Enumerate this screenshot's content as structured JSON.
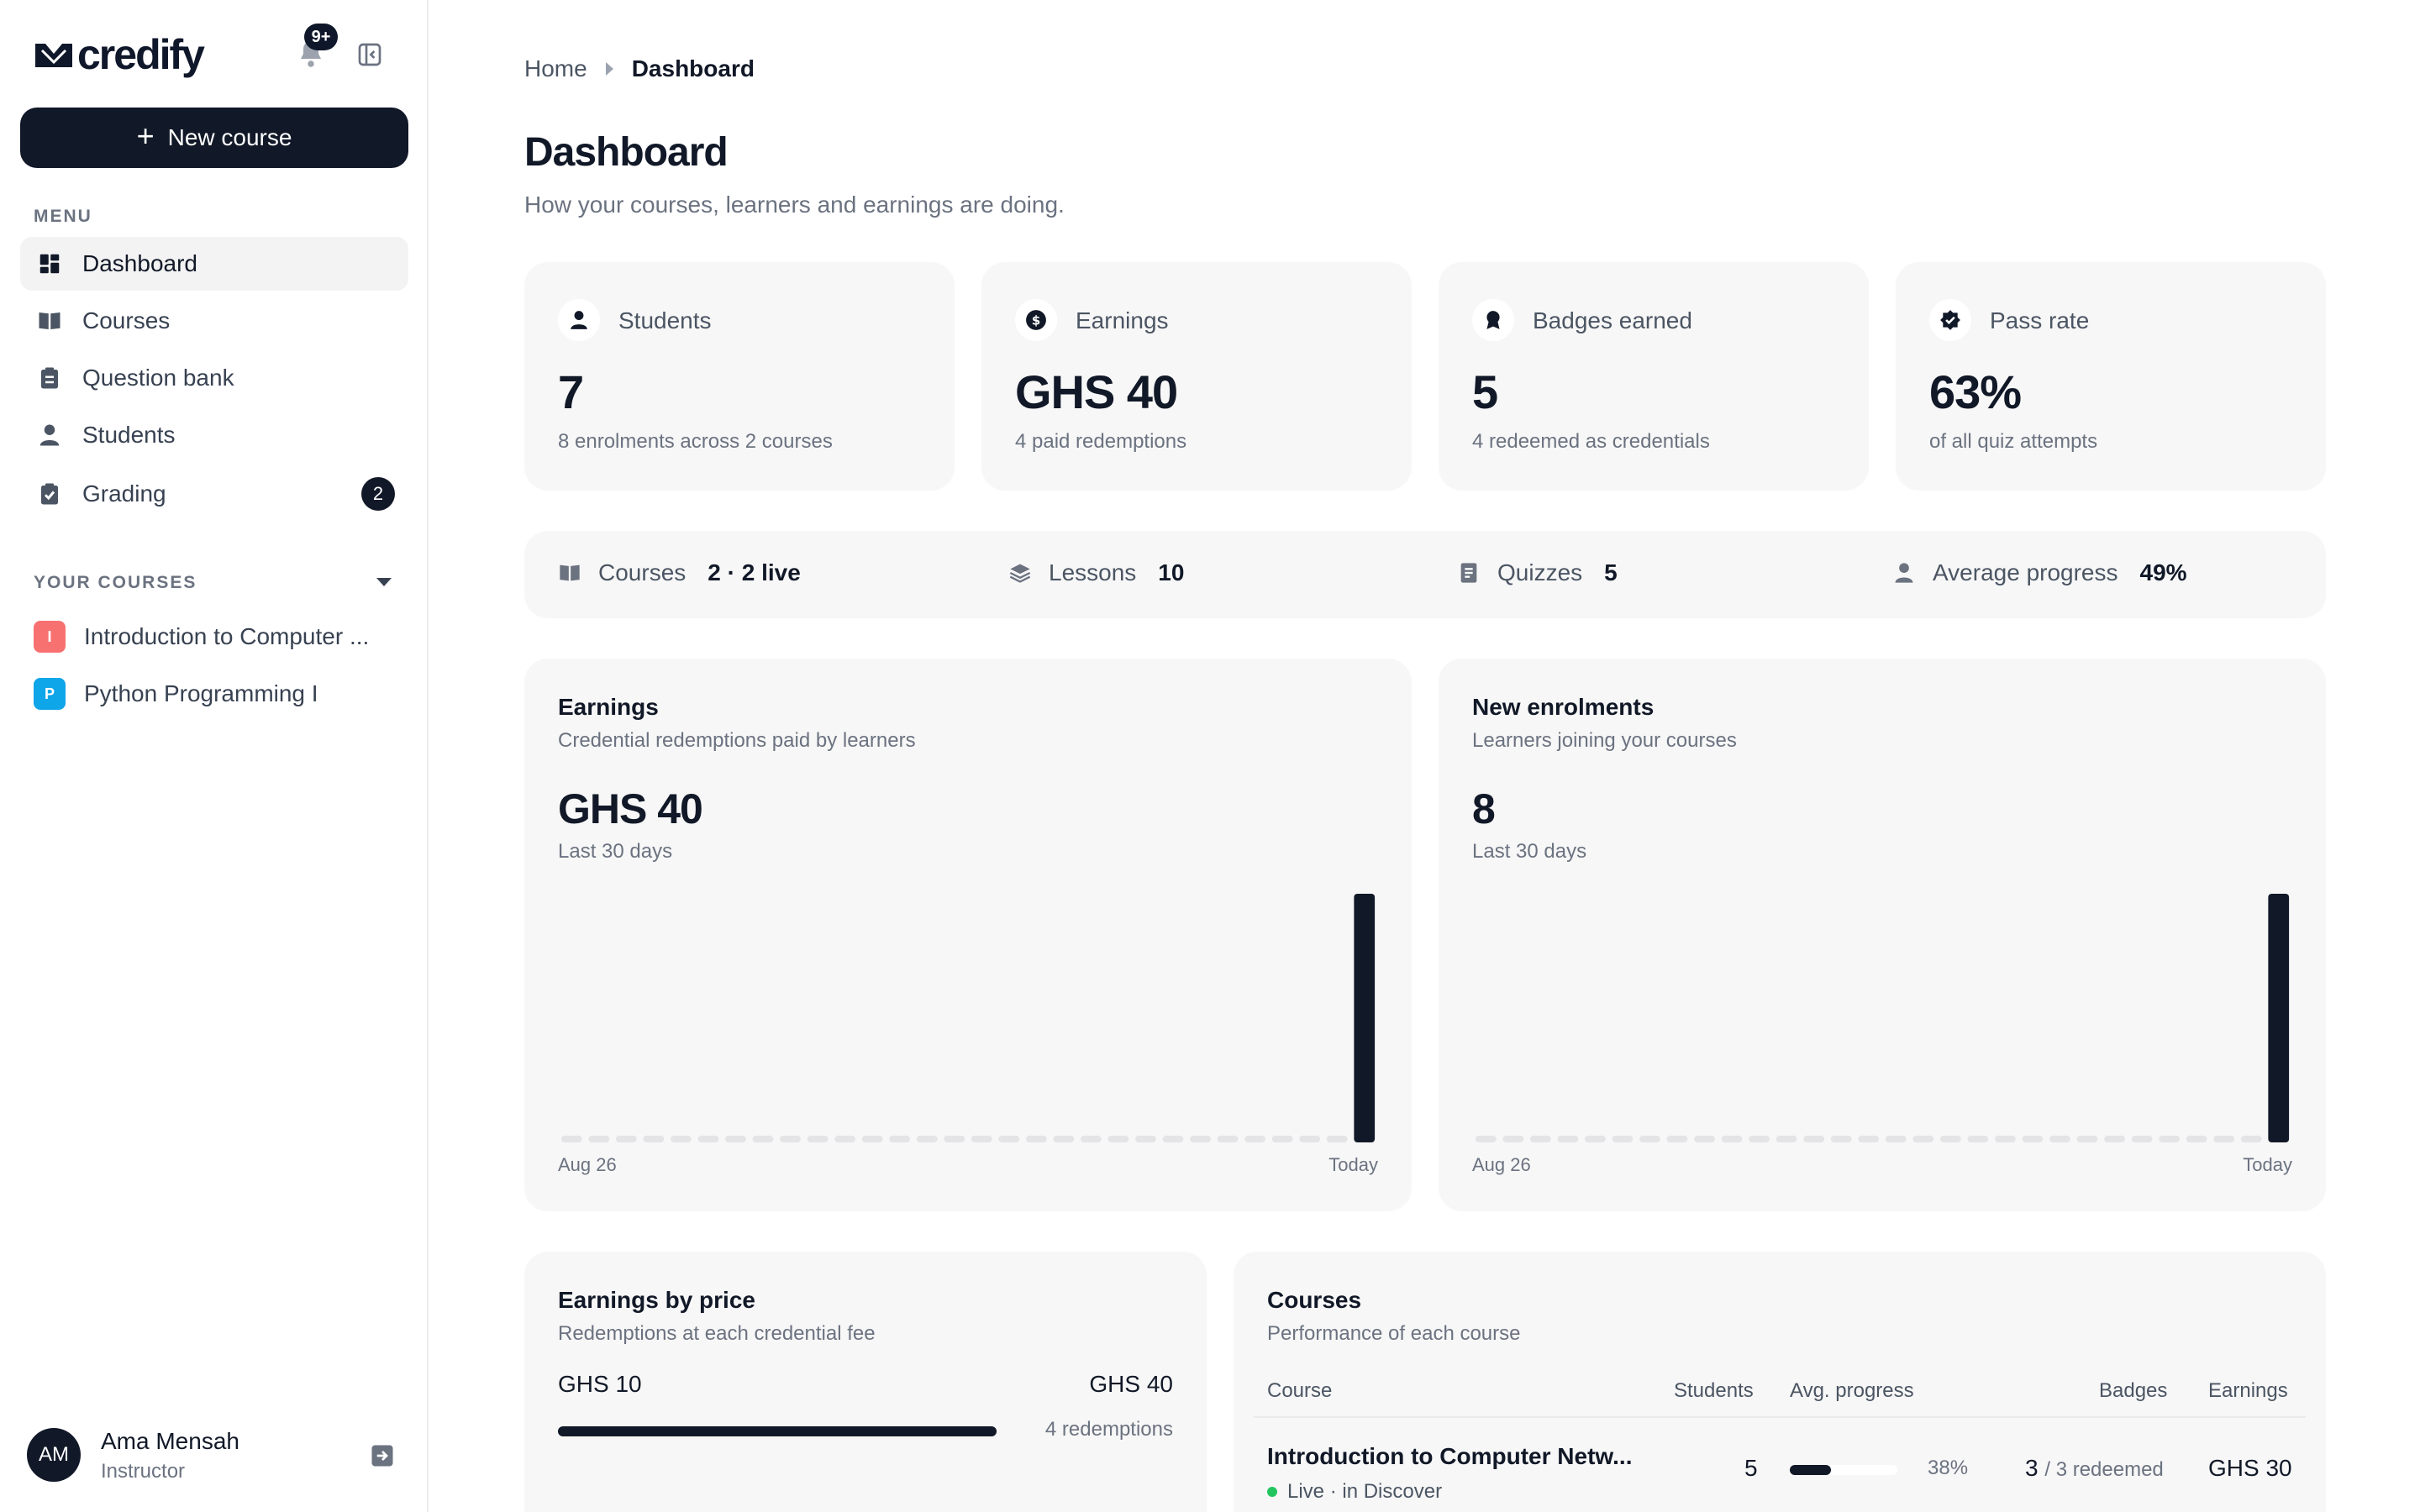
{
  "brand": {
    "name": "credify"
  },
  "notifications": {
    "badge": "9+"
  },
  "sidebar": {
    "new_course_label": "New course",
    "menu_label": "MENU",
    "items": [
      {
        "label": "Dashboard",
        "icon": "dashboard-icon",
        "active": true
      },
      {
        "label": "Courses",
        "icon": "book-icon"
      },
      {
        "label": "Question bank",
        "icon": "clipboard-icon"
      },
      {
        "label": "Students",
        "icon": "person-icon"
      },
      {
        "label": "Grading",
        "icon": "clipboard-check-icon",
        "count": "2"
      }
    ],
    "your_courses_label": "YOUR COURSES",
    "courses": [
      {
        "initial": "I",
        "label": "Introduction to Computer ...",
        "color": "#f87171"
      },
      {
        "initial": "P",
        "label": "Python Programming I",
        "color": "#0ea5e9"
      }
    ],
    "user": {
      "initials": "AM",
      "name": "Ama Mensah",
      "role": "Instructor"
    }
  },
  "breadcrumb": {
    "home": "Home",
    "current": "Dashboard"
  },
  "page": {
    "title": "Dashboard",
    "subtitle": "How your courses, learners and earnings are doing."
  },
  "stats": [
    {
      "label": "Students",
      "value": "7",
      "sub": "8 enrolments across 2 courses",
      "icon": "person-icon"
    },
    {
      "label": "Earnings",
      "value": "GHS 40",
      "sub": "4 paid redemptions",
      "icon": "dollar-icon"
    },
    {
      "label": "Badges earned",
      "value": "5",
      "sub": "4 redeemed as credentials",
      "icon": "award-icon"
    },
    {
      "label": "Pass rate",
      "value": "63%",
      "sub": "of all quiz attempts",
      "icon": "check-badge-icon"
    }
  ],
  "summary": [
    {
      "label": "Courses",
      "value": "2 · 2 live",
      "icon": "book-icon"
    },
    {
      "label": "Lessons",
      "value": "10",
      "icon": "layers-icon"
    },
    {
      "label": "Quizzes",
      "value": "5",
      "icon": "document-icon"
    },
    {
      "label": "Average progress",
      "value": "49%",
      "icon": "person-icon"
    }
  ],
  "earnings_panel": {
    "title": "Earnings",
    "subtitle": "Credential redemptions paid by learners",
    "total": "GHS 40",
    "range": "Last 30 days",
    "axis_start": "Aug 26",
    "axis_end": "Today"
  },
  "enrolments_panel": {
    "title": "New enrolments",
    "subtitle": "Learners joining your courses",
    "total": "8",
    "range": "Last 30 days",
    "axis_start": "Aug 26",
    "axis_end": "Today"
  },
  "chart_data": [
    {
      "type": "bar",
      "name": "earnings",
      "x_start": "Aug 26",
      "x_end": "Today",
      "values": [
        0,
        0,
        0,
        0,
        0,
        0,
        0,
        0,
        0,
        0,
        0,
        0,
        0,
        0,
        0,
        0,
        0,
        0,
        0,
        0,
        0,
        0,
        0,
        0,
        0,
        0,
        0,
        0,
        0,
        40
      ],
      "ylim": [
        0,
        40
      ]
    },
    {
      "type": "bar",
      "name": "enrolments",
      "x_start": "Aug 26",
      "x_end": "Today",
      "values": [
        0,
        0,
        0,
        0,
        0,
        0,
        0,
        0,
        0,
        0,
        0,
        0,
        0,
        0,
        0,
        0,
        0,
        0,
        0,
        0,
        0,
        0,
        0,
        0,
        0,
        0,
        0,
        0,
        0,
        8
      ],
      "ylim": [
        0,
        8
      ]
    }
  ],
  "price_panel": {
    "title": "Earnings by price",
    "subtitle": "Redemptions at each credential fee",
    "rows": [
      {
        "price": "GHS 10",
        "total": "GHS 40",
        "count": "4 redemptions",
        "share": 1.0
      }
    ]
  },
  "courses_panel": {
    "title": "Courses",
    "subtitle": "Performance of each course",
    "columns": [
      "Course",
      "Students",
      "Avg. progress",
      "Badges",
      "Earnings"
    ],
    "rows": [
      {
        "course": "Introduction to Computer Netw...",
        "status": "Live · in Discover",
        "students": "5",
        "progress": 0.38,
        "progress_label": "38%",
        "badges": "3",
        "badges_sub": "/ 3 redeemed",
        "earnings": "GHS 30"
      }
    ]
  },
  "colors": {
    "accent": "#111827",
    "panel": "#f7f7f7",
    "live": "#22c55e"
  }
}
